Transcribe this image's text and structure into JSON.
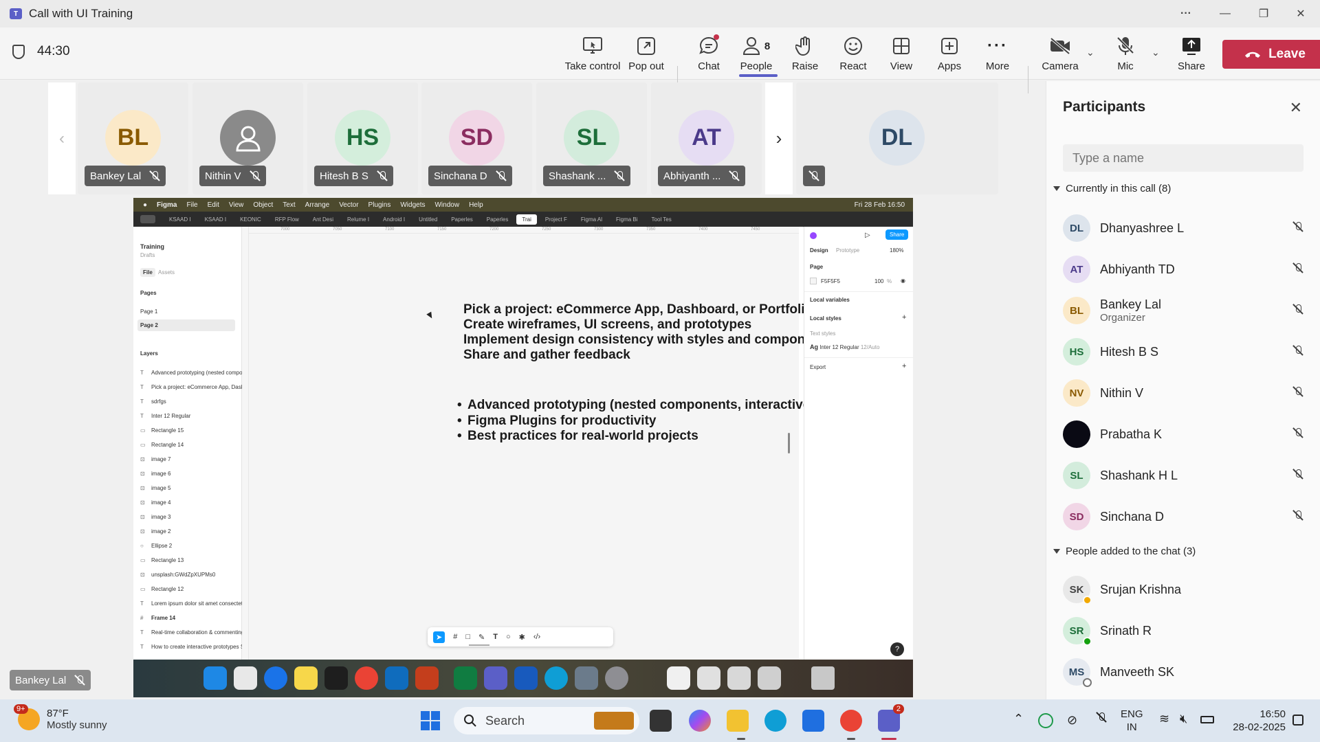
{
  "window": {
    "title": "Call with UI Training",
    "min": "—",
    "max": "❐",
    "close": "✕",
    "more": "···"
  },
  "toolbar": {
    "timer": "44:30",
    "take_control": "Take control",
    "pop_out": "Pop out",
    "chat": "Chat",
    "people": "People",
    "people_count": "8",
    "raise": "Raise",
    "react": "React",
    "view": "View",
    "apps": "Apps",
    "more": "More",
    "camera": "Camera",
    "mic": "Mic",
    "share": "Share",
    "leave": "Leave",
    "accent": "#5b5fc7",
    "leave_color": "#c4314b"
  },
  "tiles": [
    {
      "initials": "BL",
      "name": "Bankey Lal",
      "bg": "#fbe9c8",
      "fg": "#8a5a00"
    },
    {
      "initials": "",
      "name": "Nithin V",
      "bg": "#8a8a8a",
      "fg": "#ffffff"
    },
    {
      "initials": "HS",
      "name": "Hitesh B S",
      "bg": "#d4eedc",
      "fg": "#1d6e3a"
    },
    {
      "initials": "SD",
      "name": "Sinchana D",
      "bg": "#f1d6e6",
      "fg": "#8b2d60"
    },
    {
      "initials": "SL",
      "name": "Shashank ...",
      "bg": "#d3ecdc",
      "fg": "#1d6e3a"
    },
    {
      "initials": "AT",
      "name": "Abhiyanth ...",
      "bg": "#e6ddf3",
      "fg": "#4b3a8a"
    },
    {
      "initials": "DL",
      "name": "",
      "bg": "#dde4ec",
      "fg": "#2e4a66"
    }
  ],
  "figma": {
    "menubar": [
      "Figma",
      "File",
      "Edit",
      "View",
      "Object",
      "Text",
      "Arrange",
      "Vector",
      "Plugins",
      "Widgets",
      "Window",
      "Help"
    ],
    "menubar_clock": "Fri 28 Feb 16:50",
    "tabs": [
      "KSAAD I",
      "KSAAD I",
      "KEONIC",
      "RFP Flow",
      "Ant Desi",
      "Relume I",
      "Android I",
      "Untitled",
      "Paperles",
      "Paperles",
      "Trai",
      "Project F",
      "Figma Al",
      "Figma Bi",
      "Tool Tes"
    ],
    "file_name": "Training",
    "drafts": "Drafts",
    "file_tab": "File",
    "assets_tab": "Assets",
    "pages_label": "Pages",
    "pages": [
      "Page 1",
      "Page 2"
    ],
    "layers_label": "Layers",
    "layers": [
      {
        "type": "T",
        "name": "Advanced prototyping (nested compo"
      },
      {
        "type": "T",
        "name": "Pick a project: eCommerce App, Dashb"
      },
      {
        "type": "T",
        "name": "sdrfgs"
      },
      {
        "type": "T",
        "name": "Inter 12 Regular"
      },
      {
        "type": "▭",
        "name": "Rectangle 15"
      },
      {
        "type": "▭",
        "name": "Rectangle 14"
      },
      {
        "type": "⊡",
        "name": "image 7"
      },
      {
        "type": "⊡",
        "name": "image 6"
      },
      {
        "type": "⊡",
        "name": "image 5"
      },
      {
        "type": "⊡",
        "name": "image 4"
      },
      {
        "type": "⊡",
        "name": "image 3"
      },
      {
        "type": "⊡",
        "name": "image 2"
      },
      {
        "type": "○",
        "name": "Ellipse 2"
      },
      {
        "type": "▭",
        "name": "Rectangle 13"
      },
      {
        "type": "⊡",
        "name": "unsplash:GWdZpXUPMs0"
      },
      {
        "type": "▭",
        "name": "Rectangle 12"
      },
      {
        "type": "T",
        "name": "Lorem ipsum dolor sit amet consectet"
      },
      {
        "type": "#",
        "name": "Frame 14"
      },
      {
        "type": "T",
        "name": "Real-time collaboration & commenting"
      },
      {
        "type": "T",
        "name": "How to create interactive prototypes S"
      }
    ],
    "canvas_lines": [
      "Pick a project: eCommerce App, Dashboard, or Portfolio Website",
      "Create wireframes, UI screens, and prototypes",
      "Implement design consistency with styles and components",
      "Share and gather feedback"
    ],
    "canvas_bullets": [
      "Advanced prototyping (nested components, interactive variants)",
      "Figma Plugins for productivity",
      "Best practices for real-world projects"
    ],
    "ruler_ticks": [
      "7000",
      "7050",
      "7100",
      "7150",
      "7200",
      "7250",
      "7300",
      "7350",
      "7400",
      "7450",
      "7500"
    ],
    "right": {
      "design_tab": "Design",
      "prototype_tab": "Prototype",
      "zoom": "180%",
      "share": "Share",
      "page_label": "Page",
      "page_color": "F5F5F5",
      "page_opacity": "100",
      "pct": "%",
      "local_variables": "Local variables",
      "local_styles": "Local styles",
      "text_styles": "Text styles",
      "text_style_name": "Inter 12 Regular",
      "text_style_spec": "12/Auto",
      "export": "Export"
    }
  },
  "self_view": {
    "name": "Bankey Lal"
  },
  "panel": {
    "title": "Participants",
    "search_placeholder": "Type a name",
    "in_call_header": "Currently in this call (8)",
    "in_call": [
      {
        "initials": "DL",
        "name": "Dhanyashree L",
        "sub": "",
        "bg": "#dde4ec",
        "fg": "#2e4a66"
      },
      {
        "initials": "AT",
        "name": "Abhiyanth TD",
        "sub": "",
        "bg": "#e6ddf3",
        "fg": "#4b3a8a"
      },
      {
        "initials": "BL",
        "name": "Bankey Lal",
        "sub": "Organizer",
        "bg": "#fbe9c8",
        "fg": "#8a5a00"
      },
      {
        "initials": "HS",
        "name": "Hitesh B S",
        "sub": "",
        "bg": "#d4eedc",
        "fg": "#1d6e3a"
      },
      {
        "initials": "NV",
        "name": "Nithin V",
        "sub": "",
        "bg": "#fbe9c8",
        "fg": "#8a5a00"
      },
      {
        "initials": "",
        "name": "Prabatha K",
        "sub": "",
        "bg": "#0a0a14",
        "fg": "#ffffff"
      },
      {
        "initials": "SL",
        "name": "Shashank H L",
        "sub": "",
        "bg": "#d3ecdc",
        "fg": "#1d6e3a"
      },
      {
        "initials": "SD",
        "name": "Sinchana D",
        "sub": "",
        "bg": "#f1d6e6",
        "fg": "#8b2d60"
      }
    ],
    "added_header": "People added to the chat (3)",
    "added": [
      {
        "initials": "SK",
        "name": "Srujan Krishna",
        "bg": "#e8e8e8",
        "fg": "#444444",
        "status": "#f2a900"
      },
      {
        "initials": "SR",
        "name": "Srinath R",
        "bg": "#d4eedc",
        "fg": "#1d6e3a",
        "status": "#13a10e"
      },
      {
        "initials": "MS",
        "name": "Manveeth SK",
        "bg": "#e6eaf0",
        "fg": "#2e4a66",
        "status": "#ffffff"
      }
    ]
  },
  "taskbar": {
    "weather_badge": "9+",
    "temp": "87°F",
    "condition": "Mostly sunny",
    "search": "Search",
    "teams_badge": "2",
    "lang_top": "ENG",
    "lang_bottom": "IN",
    "time": "16:50",
    "date": "28-02-2025"
  }
}
